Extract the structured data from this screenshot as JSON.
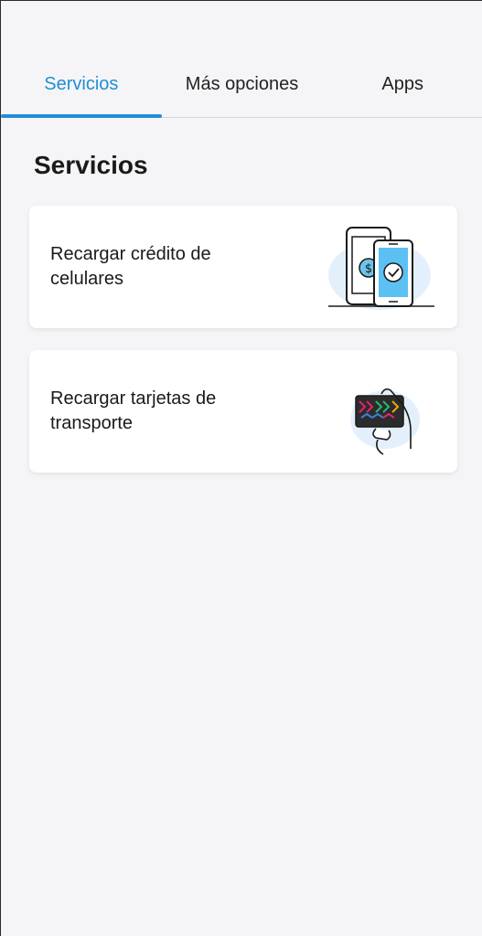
{
  "tabs": [
    {
      "label": "Servicios",
      "active": true
    },
    {
      "label": "Más opciones",
      "active": false
    },
    {
      "label": "Apps",
      "active": false
    }
  ],
  "section": {
    "title": "Servicios"
  },
  "cards": [
    {
      "label": "Recargar crédito de celulares",
      "icon": "phone-recharge-icon"
    },
    {
      "label": "Recargar tarjetas de transporte",
      "icon": "transport-card-icon"
    }
  ],
  "colors": {
    "accent": "#1f8fd6",
    "background": "#f5f5f7",
    "card": "#ffffff"
  }
}
